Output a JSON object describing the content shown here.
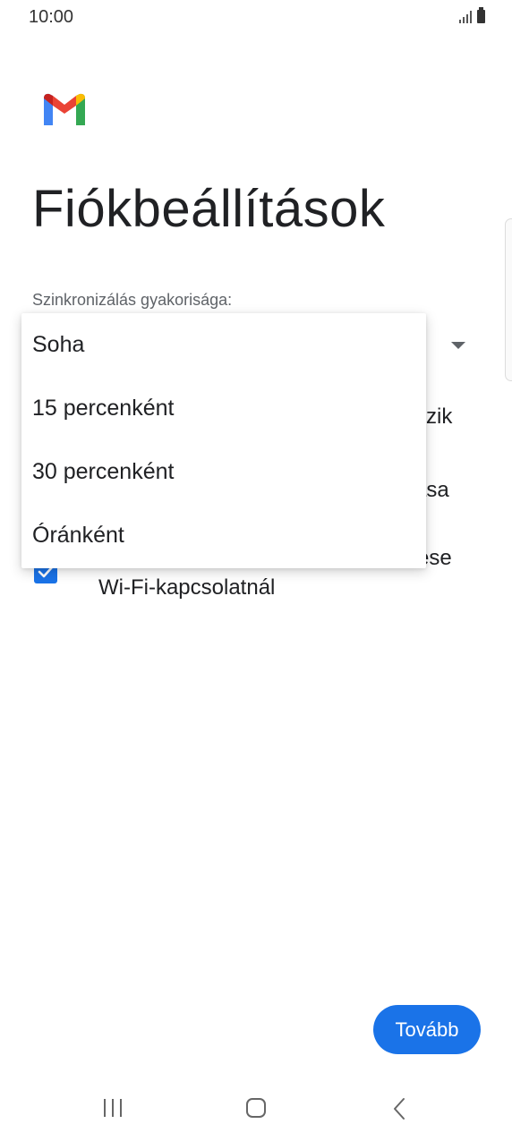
{
  "status_bar": {
    "time": "10:00"
  },
  "header": {
    "title": "Fiókbeállítások"
  },
  "sync": {
    "label": "Szinkronizálás gyakorisága:",
    "menu_items": [
      "Soha",
      "15 percenként",
      "30 percenként",
      "Óránként"
    ]
  },
  "options": {
    "option1_tail": "zik",
    "option2_tail": "ása",
    "option3_tail": "ese",
    "option3_line2": "Wi-Fi-kapcsolatnál"
  },
  "footer": {
    "next_label": "Tovább"
  },
  "colors": {
    "accent": "#1a73e8",
    "text": "#202124",
    "secondary_text": "#5f6368"
  },
  "icons": {
    "logo": "gmail-logo-icon",
    "signal": "signal-icon",
    "battery": "battery-icon",
    "dropdown": "chevron-down-icon",
    "checkbox": "checkbox-checked-icon",
    "recents": "recents-icon",
    "home": "home-icon",
    "back": "back-icon"
  }
}
